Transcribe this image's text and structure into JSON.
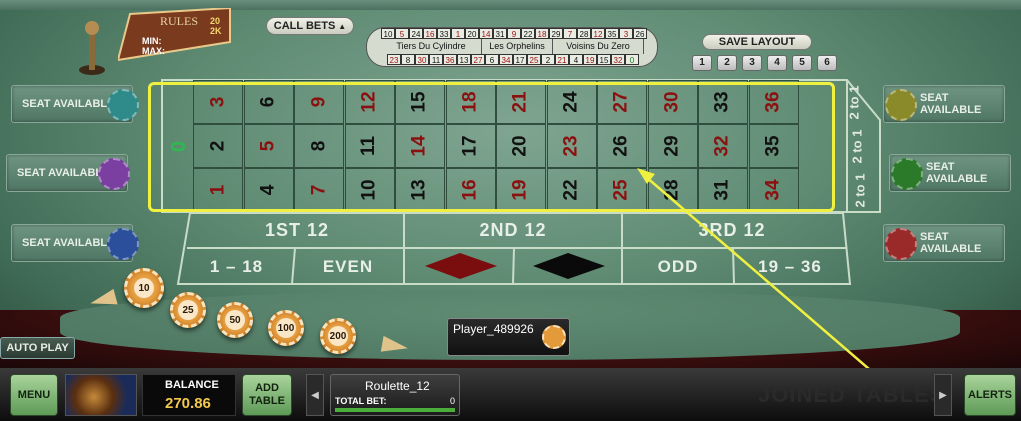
{
  "rules_card": {
    "title": "RULES",
    "min_label": "MIN:",
    "max_label": "MAX:",
    "min_value": "20",
    "max_value": "2K"
  },
  "call_bets_label": "CALL BETS",
  "racetrack": {
    "top_numbers": [
      "10",
      "5",
      "24",
      "16",
      "33",
      "1",
      "20",
      "14",
      "31",
      "9",
      "22",
      "18",
      "29",
      "7",
      "28",
      "12",
      "35",
      "3",
      "26"
    ],
    "bottom_numbers": [
      "23",
      "8",
      "30",
      "11",
      "36",
      "13",
      "27",
      "6",
      "34",
      "17",
      "25",
      "2",
      "21",
      "4",
      "19",
      "15",
      "32",
      "0"
    ],
    "sections": [
      "Tiers Du Cylindre",
      "Les Orphelins",
      "Voisins Du Zero"
    ]
  },
  "save_layout": {
    "label": "SAVE LAYOUT",
    "slots": [
      "1",
      "2",
      "3",
      "4",
      "5",
      "6"
    ]
  },
  "seats_left": [
    "SEAT AVAILABLE",
    "SEAT AVAILABLE",
    "SEAT AVAILABLE"
  ],
  "seats_right": [
    "SEAT AVAILABLE",
    "SEAT AVAILABLE",
    "SEAT AVAILABLE"
  ],
  "table": {
    "zero": "0",
    "rows": [
      [
        {
          "n": "3",
          "c": "red"
        },
        {
          "n": "6",
          "c": "black"
        },
        {
          "n": "9",
          "c": "red"
        },
        {
          "n": "12",
          "c": "red"
        },
        {
          "n": "15",
          "c": "black"
        },
        {
          "n": "18",
          "c": "red"
        },
        {
          "n": "21",
          "c": "red"
        },
        {
          "n": "24",
          "c": "black"
        },
        {
          "n": "27",
          "c": "red"
        },
        {
          "n": "30",
          "c": "red"
        },
        {
          "n": "33",
          "c": "black"
        },
        {
          "n": "36",
          "c": "red"
        }
      ],
      [
        {
          "n": "2",
          "c": "black"
        },
        {
          "n": "5",
          "c": "red"
        },
        {
          "n": "8",
          "c": "black"
        },
        {
          "n": "11",
          "c": "black"
        },
        {
          "n": "14",
          "c": "red"
        },
        {
          "n": "17",
          "c": "black"
        },
        {
          "n": "20",
          "c": "black"
        },
        {
          "n": "23",
          "c": "red"
        },
        {
          "n": "26",
          "c": "black"
        },
        {
          "n": "29",
          "c": "black"
        },
        {
          "n": "32",
          "c": "red"
        },
        {
          "n": "35",
          "c": "black"
        }
      ],
      [
        {
          "n": "1",
          "c": "red"
        },
        {
          "n": "4",
          "c": "black"
        },
        {
          "n": "7",
          "c": "red"
        },
        {
          "n": "10",
          "c": "black"
        },
        {
          "n": "13",
          "c": "black"
        },
        {
          "n": "16",
          "c": "red"
        },
        {
          "n": "19",
          "c": "red"
        },
        {
          "n": "22",
          "c": "black"
        },
        {
          "n": "25",
          "c": "red"
        },
        {
          "n": "28",
          "c": "black"
        },
        {
          "n": "31",
          "c": "black"
        },
        {
          "n": "34",
          "c": "red"
        }
      ]
    ],
    "column_bets": [
      "2 to 1",
      "2 to 1",
      "2 to 1"
    ],
    "dozens": [
      "1ST 12",
      "2ND 12",
      "3RD 12"
    ],
    "outside": [
      "1 – 18",
      "EVEN",
      "ODD",
      "19 – 36"
    ]
  },
  "chips": [
    "10",
    "25",
    "50",
    "100",
    "200"
  ],
  "player_name": "Player_489926",
  "auto_play_label": "AUTO PLAY",
  "bottom_bar": {
    "menu": "MENU",
    "balance_label": "BALANCE",
    "balance_value": "270.86",
    "add_table": "ADD TABLE",
    "table_name": "Roulette_12",
    "total_bet_label": "TOTAL BET:",
    "total_bet_value": "0",
    "joined_tables": "JOINED TABLES",
    "alerts": "ALERTS"
  },
  "colors": {
    "red_number": "#8b1010",
    "highlight": "#f0f040",
    "felt": "#5f8b73"
  }
}
